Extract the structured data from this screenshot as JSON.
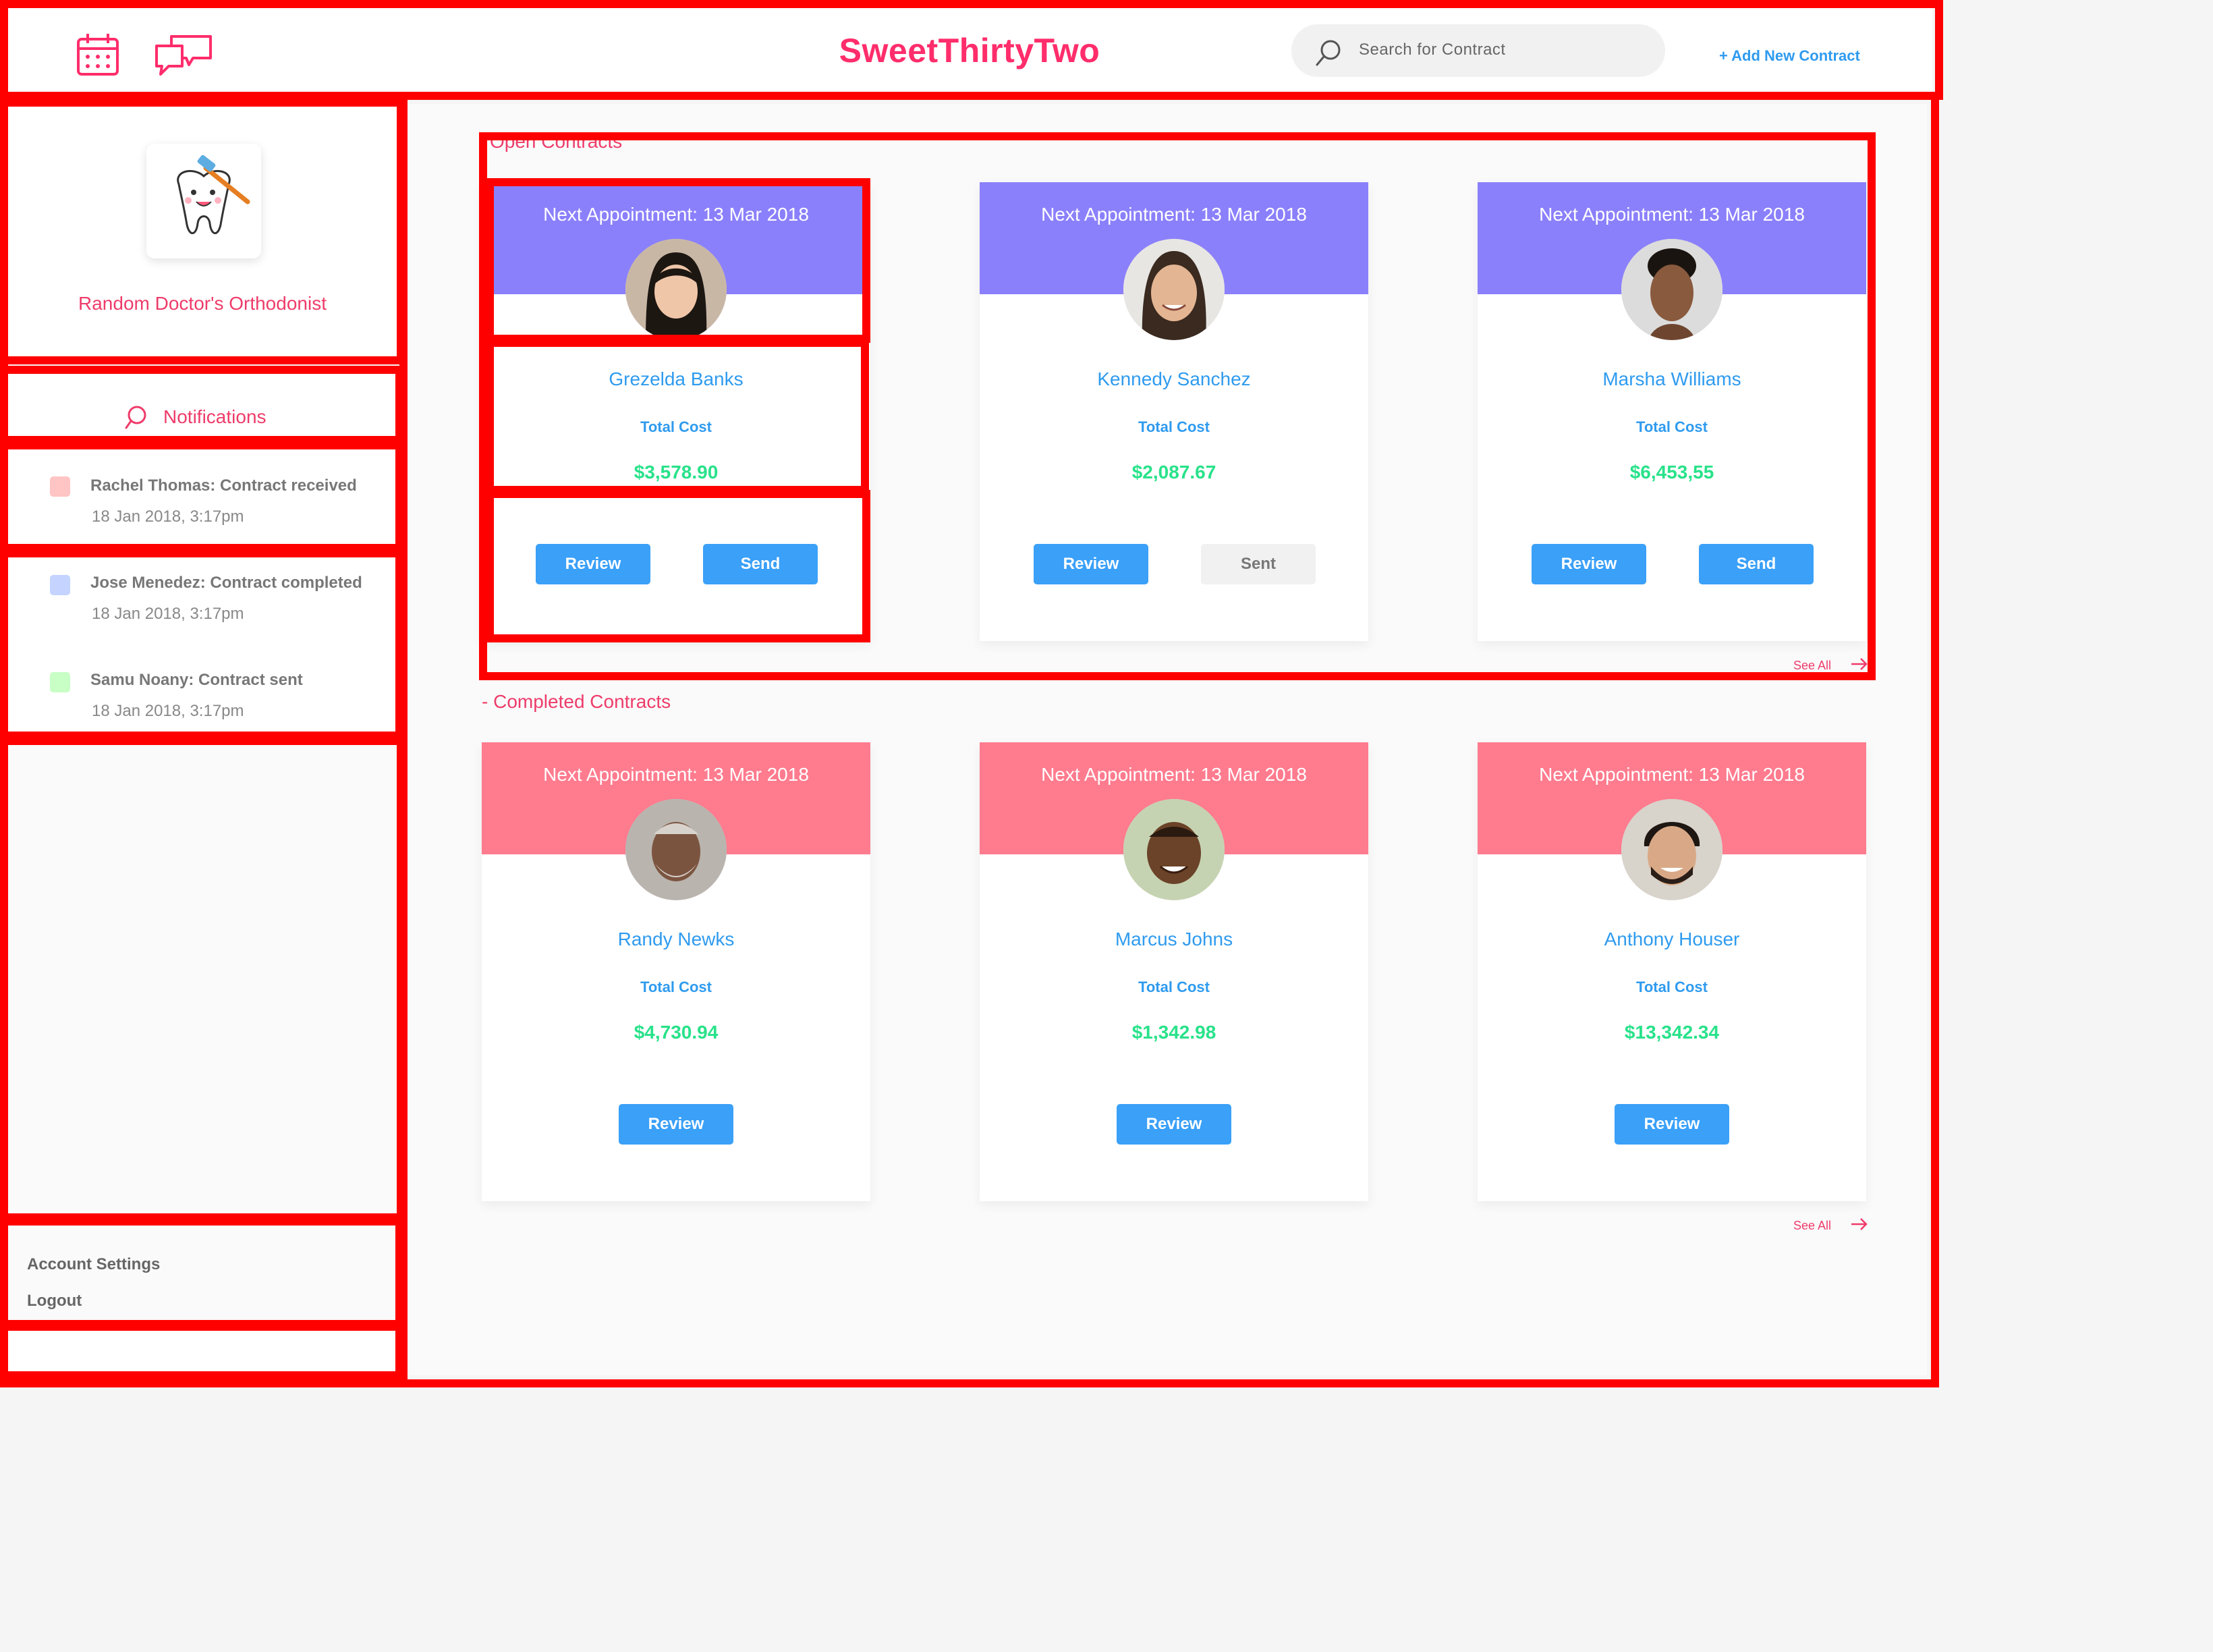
{
  "header": {
    "brand": "SweetThirtyTwo",
    "search_placeholder": "Search for Contract",
    "add_contract_label": "+ Add New Contract",
    "accent": "#ff2d6b",
    "icons": [
      "calendar-icon",
      "chat-icon",
      "search-icon"
    ]
  },
  "sidebar": {
    "clinic_name": "Random Doctor's Orthodonist",
    "notifications_title": "Notifications",
    "notifications": [
      {
        "text": "Rachel Thomas: Contract received",
        "time": "18 Jan 2018, 3:17pm",
        "color": "#ffc4c4"
      },
      {
        "text": "Jose Menedez: Contract completed",
        "time": "18 Jan 2018, 3:17pm",
        "color": "#c4d3ff"
      },
      {
        "text": "Samu Noany: Contract sent",
        "time": "18 Jan 2018, 3:17pm",
        "color": "#c7ffc4"
      }
    ],
    "account_settings": "Account Settings",
    "logout": "Logout"
  },
  "open_contracts": {
    "title": "Open Contracts",
    "see_all": "See All",
    "header_color": "#8b80fb",
    "cards": [
      {
        "appointment": "Next Appointment: 13 Mar 2018",
        "name": "Grezelda Banks",
        "cost_label": "Total Cost",
        "cost": "$3,578.90",
        "buttons": [
          "Review",
          "Send"
        ]
      },
      {
        "appointment": "Next Appointment: 13 Mar 2018",
        "name": "Kennedy Sanchez",
        "cost_label": "Total Cost",
        "cost": "$2,087.67",
        "buttons": [
          "Review",
          "Sent"
        ]
      },
      {
        "appointment": "Next Appointment: 13 Mar 2018",
        "name": "Marsha Williams",
        "cost_label": "Total Cost",
        "cost": "$6,453,55",
        "buttons": [
          "Review",
          "Send"
        ]
      }
    ]
  },
  "completed_contracts": {
    "title": "- Completed Contracts",
    "see_all": "See All",
    "header_color": "#ff7b8e",
    "cards": [
      {
        "appointment": "Next Appointment: 13 Mar 2018",
        "name": "Randy Newks",
        "cost_label": "Total Cost",
        "cost": "$4,730.94",
        "buttons": [
          "Review"
        ]
      },
      {
        "appointment": "Next Appointment: 13 Mar 2018",
        "name": "Marcus Johns",
        "cost_label": "Total Cost",
        "cost": "$1,342.98",
        "buttons": [
          "Review"
        ]
      },
      {
        "appointment": "Next Appointment: 13 Mar 2018",
        "name": "Anthony Houser",
        "cost_label": "Total Cost",
        "cost": "$13,342.34",
        "buttons": [
          "Review"
        ]
      }
    ]
  }
}
